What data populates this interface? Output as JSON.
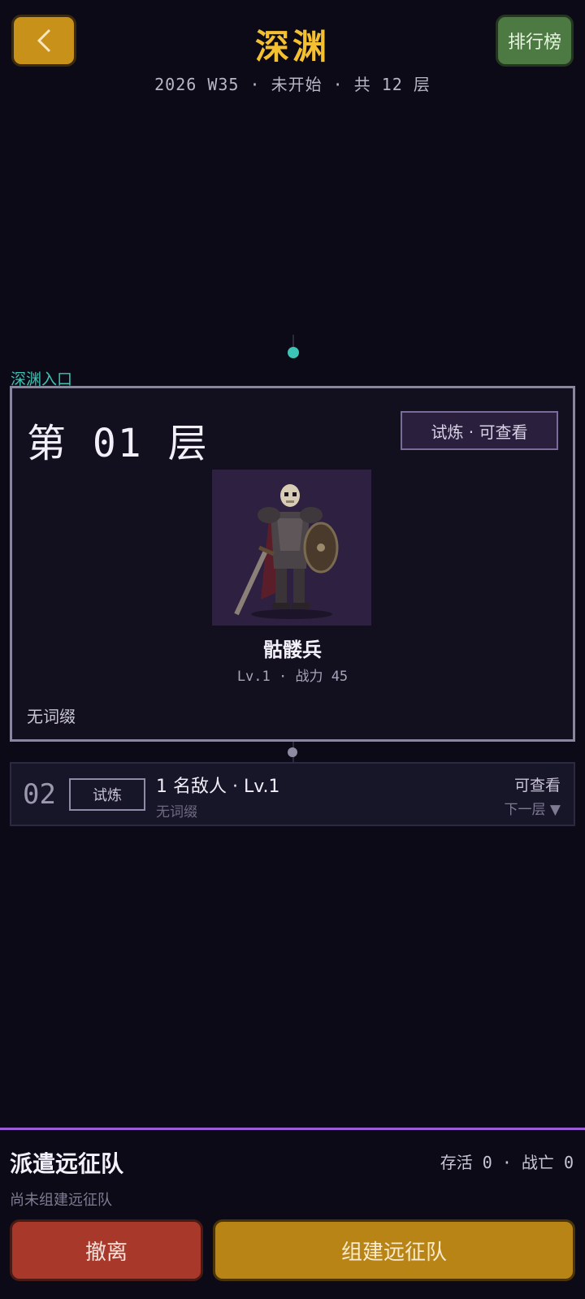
{
  "header": {
    "back_icon": "chevron-left-icon",
    "title": "深渊",
    "subtitle": "2026 W35 · 未开始 · 共 12 层",
    "rank_label": "排行榜"
  },
  "entry_label": "深渊入口",
  "floor1": {
    "title": "第 01 层",
    "badge": "试炼 · 可查看",
    "enemy_name": "骷髅兵",
    "enemy_stats": "Lv.1 · 战力 45",
    "affix": "无词缀"
  },
  "floor2": {
    "number": "02",
    "badge": "试炼",
    "summary": "1 名敌人 · Lv.1",
    "affix": "无词缀",
    "state": "可查看",
    "next": "下一层 ▼"
  },
  "dispatch": {
    "title": "派遣远征队",
    "stats": "存活 0 · 战亡 0",
    "note": "尚未组建远征队",
    "retreat_label": "撤离",
    "form_label": "组建远征队"
  },
  "colors": {
    "accent_gold": "#f5c030",
    "teal": "#3cc4b4",
    "purple_line": "#9c5cd8",
    "retreat_red": "#a8392a",
    "form_gold": "#b88416",
    "rank_green": "#4c7a42"
  }
}
